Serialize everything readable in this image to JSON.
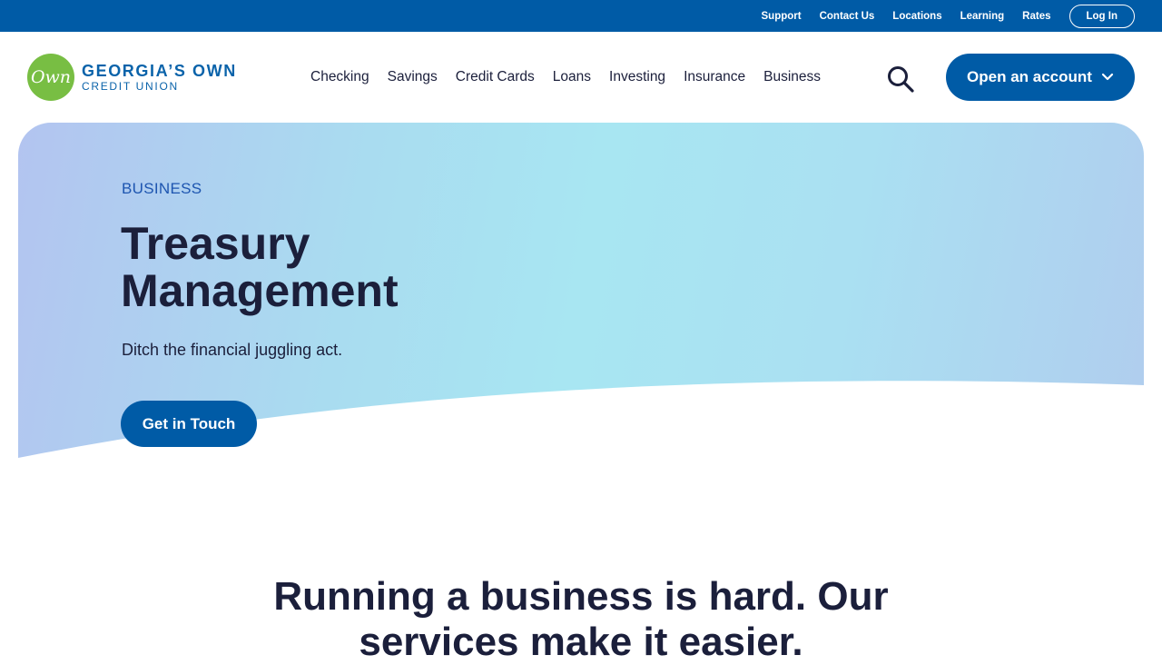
{
  "topbar": {
    "links": [
      "Support",
      "Contact Us",
      "Locations",
      "Learning",
      "Rates"
    ],
    "login_label": "Log In",
    "color": "#005ba6"
  },
  "logo": {
    "mark_text": "Own",
    "line1": "GEORGIA’S OWN",
    "line2": "CREDIT UNION",
    "green": "#78be43"
  },
  "nav": {
    "items": [
      "Checking",
      "Savings",
      "Credit Cards",
      "Loans",
      "Investing",
      "Insurance",
      "Business"
    ],
    "search_icon": "search-icon",
    "open_account_label": "Open an account",
    "open_account_icon": "chevron-down-icon"
  },
  "hero": {
    "kicker": "BUSINESS",
    "title_line1": "Treasury",
    "title_line2": "Management",
    "subtitle": "Ditch the financial juggling act.",
    "cta_label": "Get in Touch"
  },
  "section": {
    "heading_line1": "Running a business is hard. Our",
    "heading_line2": "services make it easier."
  },
  "colors": {
    "brand_blue": "#005ba6",
    "text_dark": "#1b1f3b",
    "kicker_blue": "#1d55b0"
  }
}
